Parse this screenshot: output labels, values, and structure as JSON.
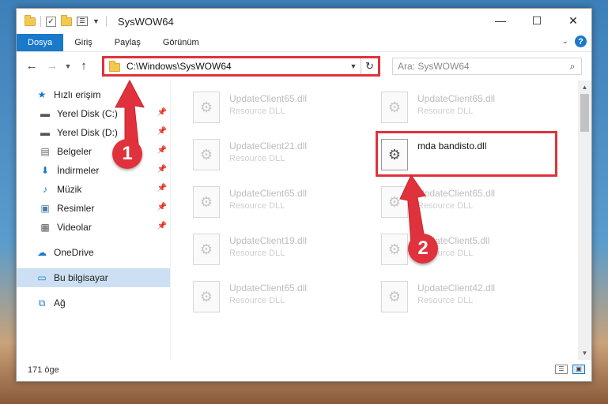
{
  "window": {
    "title": "SysWOW64",
    "controls": {
      "minimize": "—",
      "maximize": "☐",
      "close": "✕"
    }
  },
  "ribbon": {
    "tabs": [
      {
        "label": "Dosya",
        "active": true
      },
      {
        "label": "Giriş"
      },
      {
        "label": "Paylaş"
      },
      {
        "label": "Görünüm"
      }
    ],
    "help": "?"
  },
  "address": {
    "path": "C:\\Windows\\SysWOW64",
    "search_placeholder": "Ara: SysWOW64"
  },
  "sidebar": {
    "quick_access": "Hızlı erişim",
    "items": [
      {
        "label": "Yerel Disk (C:)",
        "icon": "drive-icon"
      },
      {
        "label": "Yerel Disk (D:)",
        "icon": "drive-icon"
      },
      {
        "label": "Belgeler",
        "icon": "documents-icon"
      },
      {
        "label": "İndirmeler",
        "icon": "download-icon"
      },
      {
        "label": "Müzik",
        "icon": "music-icon"
      },
      {
        "label": "Resimler",
        "icon": "pictures-icon"
      },
      {
        "label": "Videolar",
        "icon": "videos-icon"
      }
    ],
    "onedrive": "OneDrive",
    "this_pc": "Bu bilgisayar",
    "network": "Ağ"
  },
  "files": [
    {
      "name": "UpdateClient65.dll",
      "type": "Resource DLL"
    },
    {
      "name": "UpdateClient65.dll",
      "type": "Resource DLL"
    },
    {
      "name": "UpdateClient21.dll",
      "type": "Resource DLL"
    },
    {
      "name": "mda bandisto.dll",
      "type": ""
    },
    {
      "name": "UpdateClient65.dll",
      "type": "Resource DLL"
    },
    {
      "name": "UpdateClient65.dll",
      "type": "Resource DLL"
    },
    {
      "name": "UpdateClient19.dll",
      "type": "Resource DLL"
    },
    {
      "name": "UpdateClient5.dll",
      "type": "Resource DLL"
    },
    {
      "name": "UpdateClient65.dll",
      "type": "Resource DLL"
    },
    {
      "name": "UpdateClient42.dll",
      "type": "Resource DLL"
    }
  ],
  "status": {
    "item_count": "171 öge"
  },
  "callouts": {
    "one": "1",
    "two": "2"
  },
  "colors": {
    "accent": "#1979ca",
    "highlight": "#e0323c",
    "selection": "#cde0f3"
  }
}
